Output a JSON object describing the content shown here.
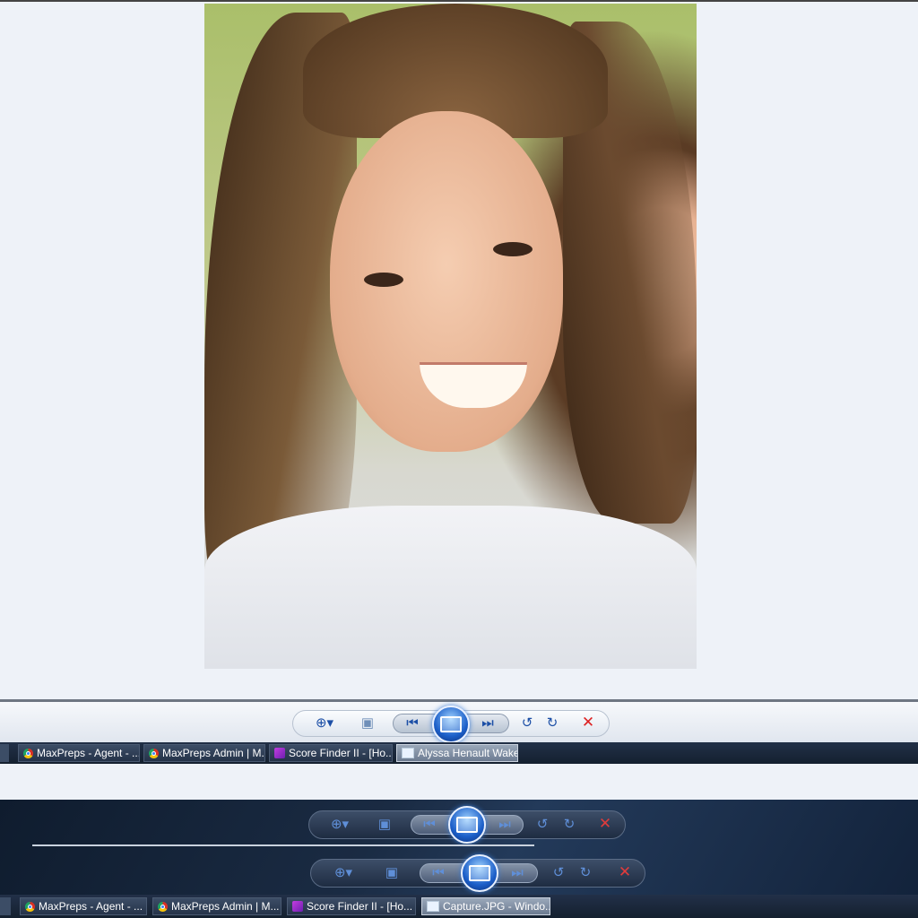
{
  "viewer": {
    "background": "#eef2f8"
  },
  "toolbar": {
    "zoom_icon": "zoom-in-icon",
    "actual_size_icon": "fit-window-icon",
    "previous_icon": "previous-icon",
    "slideshow_icon": "slideshow-icon",
    "next_icon": "next-icon",
    "rotate_left_icon": "rotate-counterclockwise-icon",
    "rotate_right_icon": "rotate-clockwise-icon",
    "delete_icon": "delete-icon"
  },
  "taskbar_top": {
    "items": [
      {
        "label": "MaxPreps - Agent - ...",
        "icon": "chrome-icon",
        "active": false
      },
      {
        "label": "MaxPreps Admin | M...",
        "icon": "chrome-icon",
        "active": false
      },
      {
        "label": "Score Finder II - [Ho...",
        "icon": "app-icon",
        "active": false
      },
      {
        "label": "Alyssa Henault Wake...",
        "icon": "photo-viewer-icon",
        "active": true
      }
    ]
  },
  "taskbar_bottom": {
    "items": [
      {
        "label": "MaxPreps - Agent - ...",
        "icon": "chrome-icon",
        "active": false
      },
      {
        "label": "MaxPreps Admin | M...",
        "icon": "chrome-icon",
        "active": false
      },
      {
        "label": "Score Finder II - [Ho...",
        "icon": "app-icon",
        "active": false
      },
      {
        "label": "Capture.JPG - Windo...",
        "icon": "photo-viewer-icon",
        "active": true
      }
    ]
  }
}
